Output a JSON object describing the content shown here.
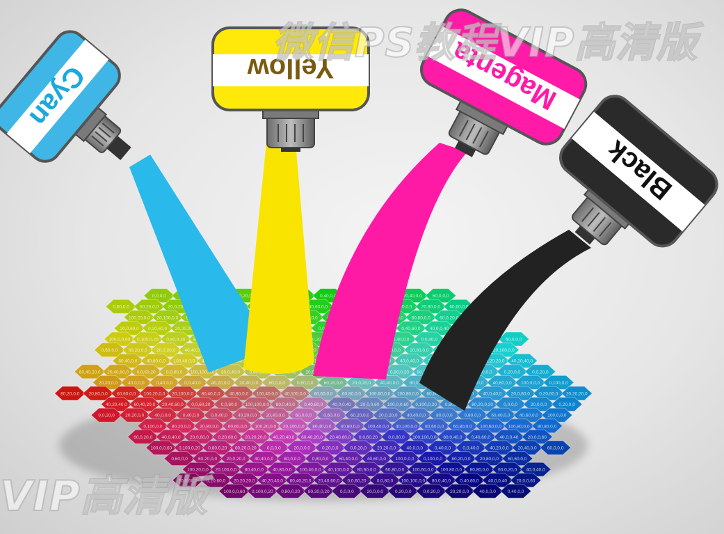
{
  "tubes": [
    {
      "id": "cyan",
      "label": "Cyan",
      "body_color": "#3fb6e6",
      "stream_color": "#29b9ea"
    },
    {
      "id": "yellow",
      "label": "Yellow",
      "body_color": "#ffe90a",
      "stream_color": "#f9e400"
    },
    {
      "id": "magenta",
      "label": "Magenta",
      "body_color": "#ff1aa8",
      "stream_color": "#ff1aa6"
    },
    {
      "id": "black",
      "label": "Black",
      "body_color": "#2a2a2a",
      "stream_color": "#222222"
    }
  ],
  "label_text_colors": {
    "cyan": "#1ba8df",
    "yellow": "#7a5a10",
    "magenta": "#ff1aa8",
    "black": "#111111"
  },
  "hex_labels": [
    "0,0,0,0",
    "20,0,0,0",
    "0,20,0,0",
    "0,0,20,0",
    "20,20,0,0",
    "40,0,0,0",
    "0,40,0,0",
    "0,0,40,0",
    "40,20,0,0",
    "20,40,0,0",
    "60,0,0,0",
    "0,60,0,0",
    "60,20,0,0",
    "20,0,20,0",
    "40,40,0,0",
    "80,0,0,0",
    "0,80,0,0",
    "60,40,0,0",
    "40,60,0,0",
    "100,0,0,0",
    "0,100,0,0",
    "80,20,0,0",
    "20,80,0,0",
    "60,60,0,0",
    "100,20,0,0",
    "20,100,0,0",
    "80,40,0,0",
    "40,80,0,0",
    "100,40,0,0",
    "40,100,0,0",
    "80,60,0,0",
    "60,80,0,0",
    "100,60,0,0",
    "100,80,0,0",
    "80,80,0,0",
    "60,0,20,0",
    "40,0,40,0",
    "20,0,60,0",
    "0,20,60,0",
    "20,20,20,0",
    "40,20,40,0",
    "60,40,20,0",
    "20,40,60,0",
    "0,0,60,20",
    "0,0,80,0",
    "100,100,0,0",
    "80,0,40,0",
    "0,40,60,0",
    "40,0,0,40",
    "20,0,0,60",
    "100,0,0,60",
    "0,100,0,20",
    "0,80,0,20",
    "80,20,0,20"
  ],
  "watermark_top": "微信PS教程VIP高清版",
  "watermark_bottom": "VIP高清版"
}
